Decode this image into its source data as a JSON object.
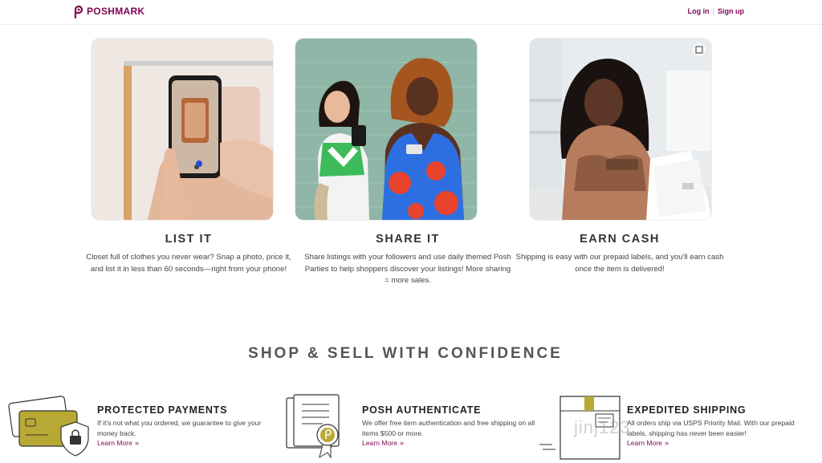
{
  "header": {
    "logo_text": "POSHMARK",
    "login": "Log in",
    "separator": "|",
    "signup": "Sign up"
  },
  "steps": [
    {
      "title": "LIST IT",
      "description": "Closet full of clothes you never wear? Snap a photo, price it, and list it in less than 60 seconds—right from your phone!"
    },
    {
      "title": "SHARE IT",
      "description": "Share listings with your followers and use daily themed Posh Parties to help shoppers discover your listings! More sharing = more sales."
    },
    {
      "title": "EARN CASH",
      "description": "Shipping is easy with our prepaid labels, and you'll earn cash once the item is delivered!"
    }
  ],
  "confidence": {
    "heading": "SHOP & SELL WITH CONFIDENCE",
    "features": [
      {
        "title": "PROTECTED PAYMENTS",
        "description": "If it's not what you ordered, we guarantee to give your money back.",
        "link": "Learn More",
        "icon": "credit-card-lock-icon"
      },
      {
        "title": "POSH AUTHENTICATE",
        "description": "We offer free item authentication and free shipping on all items $500 or more.",
        "link": "Learn More",
        "icon": "certificate-icon"
      },
      {
        "title": "EXPEDITED SHIPPING",
        "description": "All orders ship via USPS Priority Mail. With our prepaid labels, shipping has never been easier!",
        "link": "Learn More",
        "icon": "shipping-box-icon"
      }
    ]
  },
  "watermark": "jinj123",
  "colors": {
    "brand": "#7f0353",
    "accent_gold": "#b8a934"
  }
}
